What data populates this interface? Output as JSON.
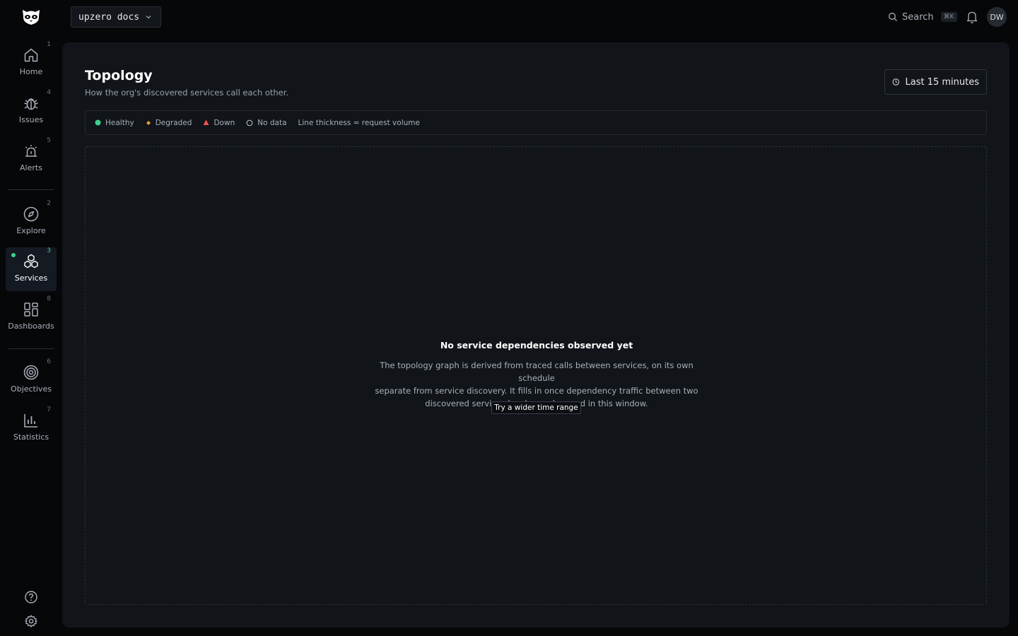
{
  "header": {
    "org_name": "upzero docs",
    "search_label": "Search",
    "search_shortcut": "⌘K",
    "avatar_initials": "DW"
  },
  "sidebar": {
    "items": [
      {
        "label": "Home",
        "shortcut": "1",
        "icon": "home-icon"
      },
      {
        "label": "Issues",
        "shortcut": "4",
        "icon": "bug-icon"
      },
      {
        "label": "Alerts",
        "shortcut": "5",
        "icon": "alarm-icon"
      },
      {
        "label": "Explore",
        "shortcut": "2",
        "icon": "compass-icon"
      },
      {
        "label": "Services",
        "shortcut": "3",
        "icon": "services-icon",
        "active": true
      },
      {
        "label": "Dashboards",
        "shortcut": "8",
        "icon": "dashboard-grid-icon"
      },
      {
        "label": "Objectives",
        "shortcut": "6",
        "icon": "target-icon"
      },
      {
        "label": "Statistics",
        "shortcut": "7",
        "icon": "bar-chart-icon"
      }
    ],
    "bottom_icons": [
      "help-icon",
      "gear-icon"
    ]
  },
  "page": {
    "title": "Topology",
    "subtitle": "How the org's discovered services call each other.",
    "time_range": "Last 15 minutes"
  },
  "legend": {
    "healthy": "Healthy",
    "degraded": "Degraded",
    "down": "Down",
    "no_data": "No data",
    "note": "Line thickness = request volume"
  },
  "empty_state": {
    "title": "No service dependencies observed yet",
    "line1": "The topology graph is derived from traced calls between services, on its own schedule",
    "line2": "separate from service discovery. It fills in once dependency traffic between two",
    "line3": "discovered services has been observed in this window.",
    "button": "Try a wider time range"
  },
  "colors": {
    "healthy": "#3ecf8e",
    "degraded": "#e8a13a",
    "down": "#ef5350",
    "accent": "#3ecf8e"
  }
}
